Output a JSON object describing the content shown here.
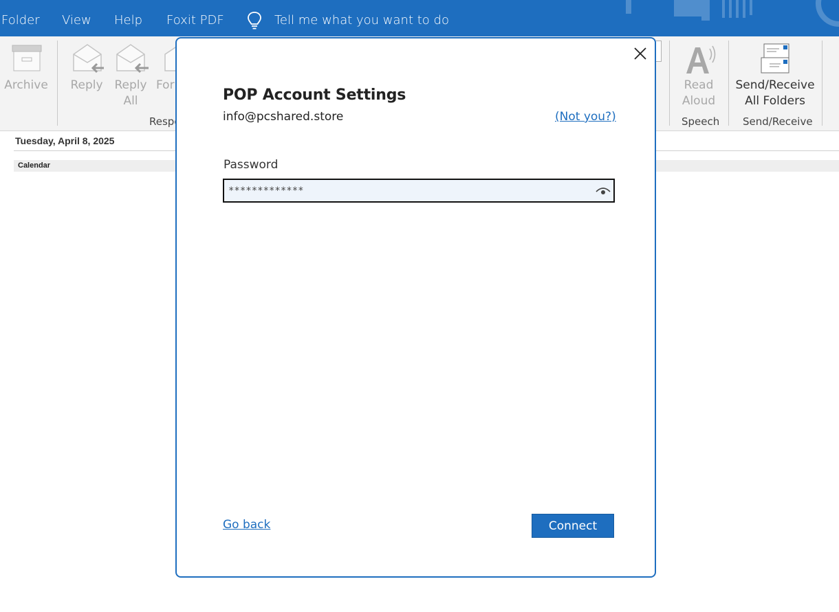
{
  "menu": {
    "items": [
      "Folder",
      "View",
      "Help",
      "Foxit PDF"
    ],
    "tell_me": "Tell me what you want to do"
  },
  "ribbon": {
    "archive": "Archive",
    "reply": "Reply",
    "reply_all_1": "Reply",
    "reply_all_2": "All",
    "forward_partial": "For",
    "respond_group_partial": "Respo",
    "read_aloud_1": "Read",
    "read_aloud_2": "Aloud",
    "speech_group": "Speech",
    "send_receive_1": "Send/Receive",
    "send_receive_2": "All Folders",
    "send_receive_group": "Send/Receive"
  },
  "calendar": {
    "date": "Tuesday, April 8, 2025",
    "label": "Calendar"
  },
  "dialog": {
    "title": "POP Account Settings",
    "email": "info@pcshared.store",
    "not_you": "(Not you?)",
    "password_label": "Password",
    "password_value": "*************",
    "go_back": "Go back",
    "connect": "Connect"
  },
  "colors": {
    "accent": "#1e6ebf",
    "ribbon_bg": "#f3f3f3",
    "input_bg": "#eef4fb"
  }
}
